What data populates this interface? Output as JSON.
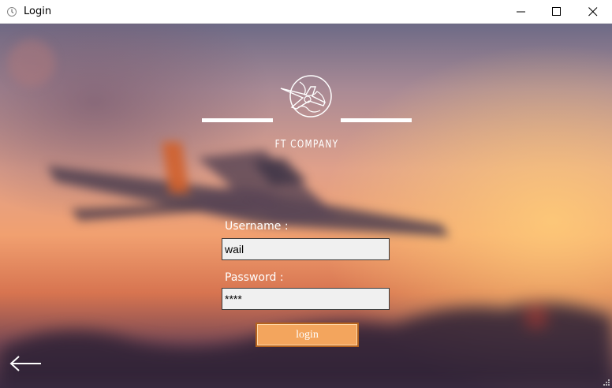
{
  "window": {
    "title": "Login"
  },
  "brand": {
    "company_name": "FT COMPANY"
  },
  "form": {
    "username_label": "Username :",
    "username_value": "wail",
    "password_label": "Password :",
    "password_value": "****",
    "login_label": "login"
  },
  "icons": {
    "app": "clock-icon",
    "minimize": "minimize-icon",
    "maximize": "maximize-icon",
    "close": "close-icon",
    "logo": "globe-plane-logo-icon",
    "back": "back-arrow-icon"
  },
  "colors": {
    "button_fill": "#f3a55d",
    "button_border": "#b4631f",
    "field_fill": "#f0f0f0"
  }
}
